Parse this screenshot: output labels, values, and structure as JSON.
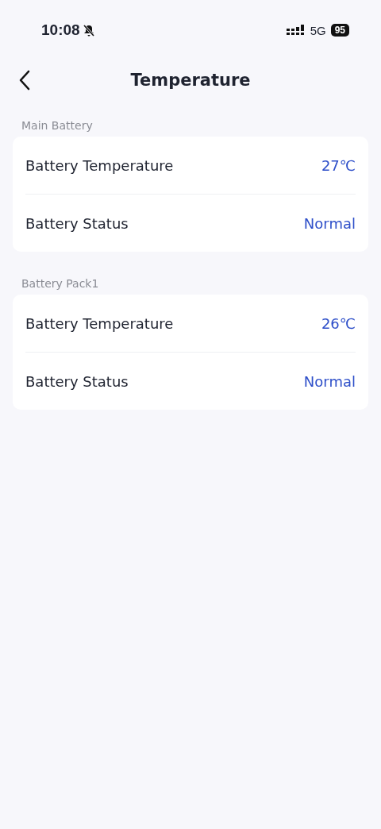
{
  "status_bar": {
    "time": "10:08",
    "network": "5G",
    "battery": "95"
  },
  "header": {
    "title": "Temperature"
  },
  "sections": [
    {
      "title": "Main Battery",
      "rows": [
        {
          "label": "Battery Temperature",
          "value": "27℃"
        },
        {
          "label": "Battery Status",
          "value": "Normal"
        }
      ]
    },
    {
      "title": "Battery Pack1",
      "rows": [
        {
          "label": "Battery Temperature",
          "value": "26℃"
        },
        {
          "label": "Battery Status",
          "value": "Normal"
        }
      ]
    }
  ]
}
